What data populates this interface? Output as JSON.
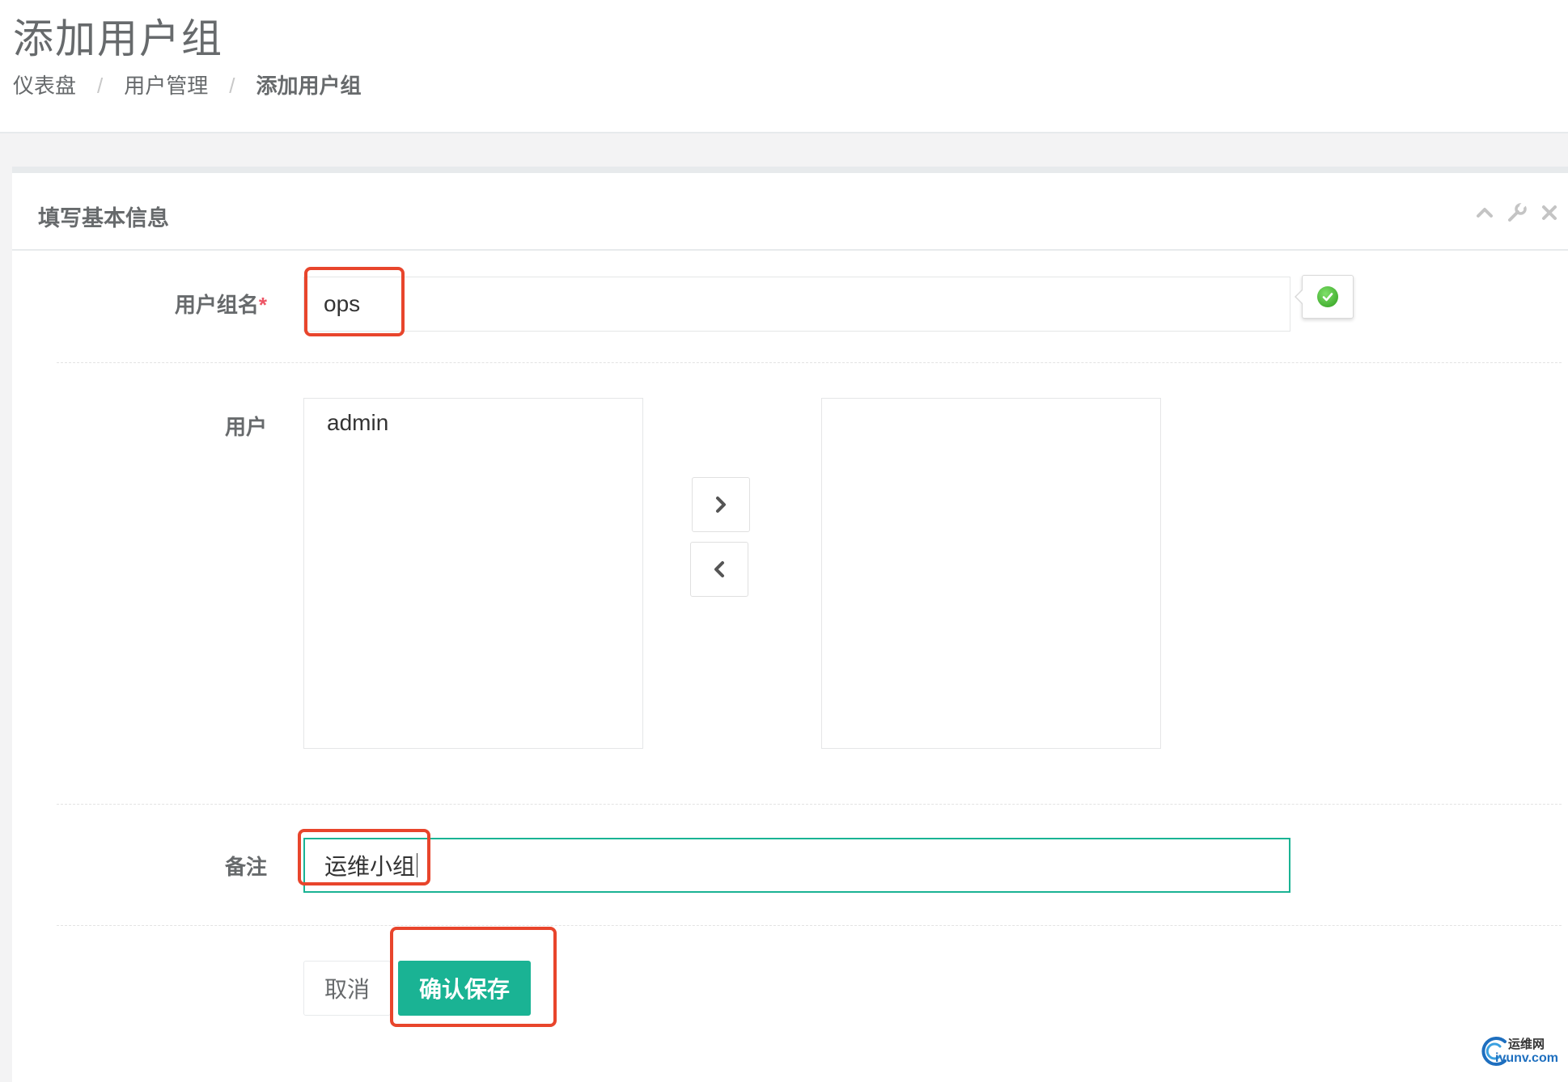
{
  "header": {
    "title": "添加用户组",
    "breadcrumb": [
      "仪表盘",
      "用户管理",
      "添加用户组"
    ],
    "breadcrumb_separator": "/"
  },
  "panel": {
    "title": "填写基本信息",
    "tools": [
      "collapse-icon",
      "wrench-icon",
      "close-icon"
    ]
  },
  "form": {
    "group_name_label": "用户组名",
    "required_mark": "*",
    "group_name_value": "ops",
    "users_label": "用户",
    "available_users": [
      "admin"
    ],
    "selected_users": [],
    "move_right_icon": "chevron-right-icon",
    "move_left_icon": "chevron-left-icon",
    "comment_label": "备注",
    "comment_value": "运维小组",
    "cancel_label": "取消",
    "save_label": "确认保存"
  },
  "watermark": {
    "line1": "运维网",
    "line2": "iyunv.com"
  },
  "colors": {
    "primary": "#1ab394",
    "annotation": "#e8452c",
    "required": "#ed5565"
  }
}
